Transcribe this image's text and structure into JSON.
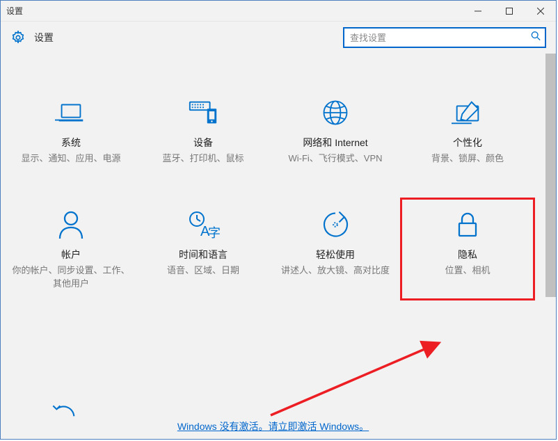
{
  "window": {
    "title": "设置"
  },
  "header": {
    "title": "设置"
  },
  "search": {
    "placeholder": "查找设置"
  },
  "tiles": [
    {
      "id": "system",
      "title": "系统",
      "subtitle": "显示、通知、应用、电源"
    },
    {
      "id": "devices",
      "title": "设备",
      "subtitle": "蓝牙、打印机、鼠标"
    },
    {
      "id": "network",
      "title": "网络和 Internet",
      "subtitle": "Wi-Fi、飞行模式、VPN"
    },
    {
      "id": "personalize",
      "title": "个性化",
      "subtitle": "背景、锁屏、颜色"
    },
    {
      "id": "accounts",
      "title": "帐户",
      "subtitle": "你的帐户、同步设置、工作、其他用户"
    },
    {
      "id": "timelang",
      "title": "时间和语言",
      "subtitle": "语音、区域、日期"
    },
    {
      "id": "ease",
      "title": "轻松使用",
      "subtitle": "讲述人、放大镜、高对比度"
    },
    {
      "id": "privacy",
      "title": "隐私",
      "subtitle": "位置、相机"
    }
  ],
  "activation": {
    "text": "Windows 没有激活。请立即激活 Windows。"
  },
  "annotation": {
    "highlight_tile": "privacy",
    "arrow_color": "#ec1e24"
  },
  "colors": {
    "accent": "#0173cd",
    "border": "#4d7fbf"
  }
}
